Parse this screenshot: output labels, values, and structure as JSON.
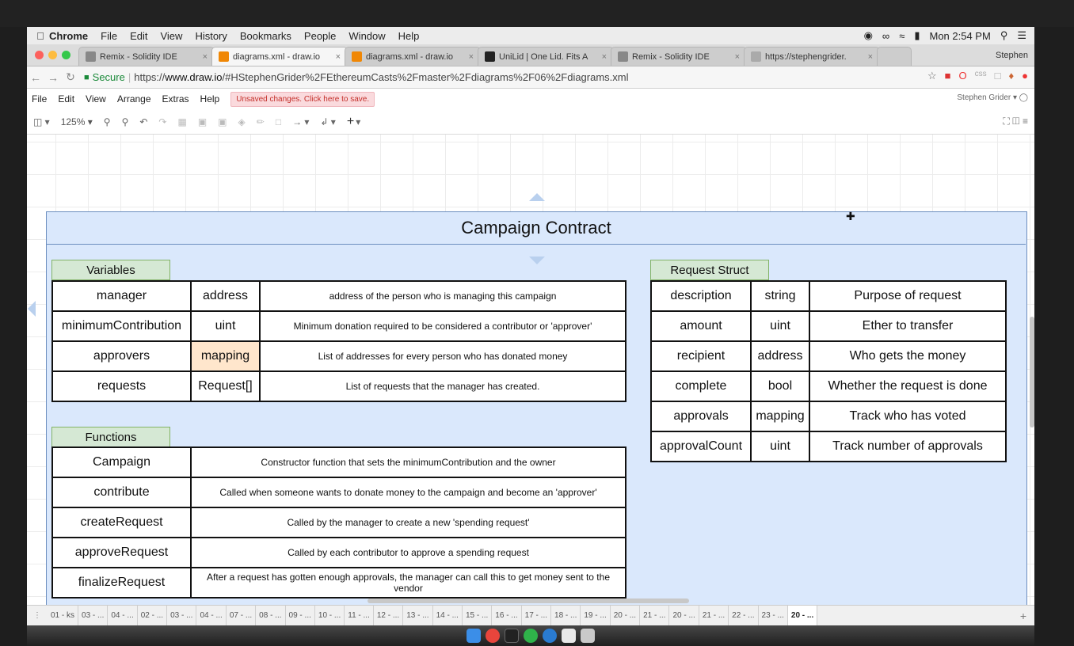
{
  "macbar": {
    "menus": [
      "Chrome",
      "File",
      "Edit",
      "View",
      "History",
      "Bookmarks",
      "People",
      "Window",
      "Help"
    ],
    "clock": "Mon 2:54 PM"
  },
  "browser": {
    "tabs": [
      {
        "label": "Remix - Solidity IDE",
        "icon": "remix-icon",
        "color": "#888888"
      },
      {
        "label": "diagrams.xml - draw.io",
        "icon": "drawio-icon",
        "color": "#f08705",
        "active": true
      },
      {
        "label": "diagrams.xml - draw.io",
        "icon": "drawio-icon",
        "color": "#f08705"
      },
      {
        "label": "UniLid | One Lid. Fits A",
        "icon": "unilid-icon",
        "color": "#222222"
      },
      {
        "label": "Remix - Solidity IDE",
        "icon": "remix-icon",
        "color": "#888888"
      },
      {
        "label": "https://stephengrider.",
        "icon": "page-icon",
        "color": "#aaaaaa"
      }
    ],
    "profile": "Stephen",
    "secure_label": "Secure",
    "url_prefix": "https://",
    "url_domain": "www.draw.io",
    "url_rest": "/#HStephenGrider%2FEthereumCasts%2Fmaster%2Fdiagrams%2F06%2Fdiagrams.xml"
  },
  "drawio": {
    "menu": [
      "File",
      "Edit",
      "View",
      "Arrange",
      "Extras",
      "Help"
    ],
    "unsaved": "Unsaved changes. Click here to save.",
    "user": "Stephen Grider",
    "zoom": "125%"
  },
  "diagram": {
    "title": "Campaign Contract",
    "variables_label": "Variables",
    "variables": [
      {
        "name": "manager",
        "type": "address",
        "desc": "address of the person who is managing this campaign"
      },
      {
        "name": "minimumContribution",
        "type": "uint",
        "desc": "Minimum donation required to be considered a contributor or 'approver'"
      },
      {
        "name": "approvers",
        "type": "mapping",
        "desc": "List of addresses for every person who has donated money"
      },
      {
        "name": "requests",
        "type": "Request[]",
        "desc": "List of requests that the manager has created."
      }
    ],
    "functions_label": "Functions",
    "functions": [
      {
        "name": "Campaign",
        "desc": "Constructor function that sets the minimumContribution and the owner"
      },
      {
        "name": "contribute",
        "desc": "Called when someone wants to donate money to the campaign and become an 'approver'"
      },
      {
        "name": "createRequest",
        "desc": "Called by the manager to create a new 'spending request'"
      },
      {
        "name": "approveRequest",
        "desc": "Called by each contributor to approve a spending request"
      },
      {
        "name": "finalizeRequest",
        "desc": "After a request has gotten enough approvals, the manager can call this to get money sent to the vendor"
      }
    ],
    "struct_label": "Request Struct",
    "struct": [
      {
        "name": "description",
        "type": "string",
        "desc": "Purpose of request"
      },
      {
        "name": "amount",
        "type": "uint",
        "desc": "Ether to transfer"
      },
      {
        "name": "recipient",
        "type": "address",
        "desc": "Who gets the money"
      },
      {
        "name": "complete",
        "type": "bool",
        "desc": "Whether the request is done"
      },
      {
        "name": "approvals",
        "type": "mapping",
        "desc": "Track who has voted"
      },
      {
        "name": "approvalCount",
        "type": "uint",
        "desc": "Track number of approvals"
      }
    ]
  },
  "pages": [
    "01 - ks",
    "03 - ...",
    "04 - ...",
    "02 - ...",
    "03 - ...",
    "04 - ...",
    "07 - ...",
    "08 - ...",
    "09 - ...",
    "10 - ...",
    "11 - ...",
    "12 - ...",
    "13 - ...",
    "14 - ...",
    "15 - ...",
    "16 - ...",
    "17 - ...",
    "18 - ...",
    "19 - ...",
    "20 - ...",
    "21 - ...",
    "20 - ...",
    "21 - ...",
    "22 - ...",
    "23 - ...",
    "20 - ..."
  ],
  "active_page_index": 25,
  "colors": {
    "container_fill": "#dae8fc",
    "container_stroke": "#6c8ebf",
    "label_fill": "#d5e8d4",
    "label_stroke": "#82b366",
    "highlight": "#ffe6cc"
  }
}
